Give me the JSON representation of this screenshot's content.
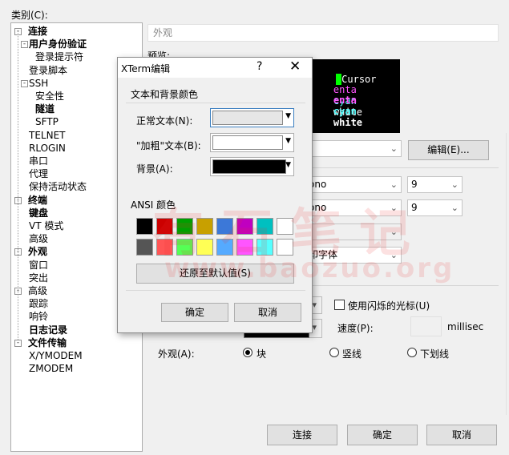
{
  "category_label": "类别(C):",
  "tree": [
    {
      "label": "连接",
      "bold": true,
      "level": 0,
      "toggle": "-"
    },
    {
      "label": "用户身份验证",
      "bold": true,
      "level": 1,
      "toggle": "-"
    },
    {
      "label": "登录提示符",
      "bold": false,
      "level": 2,
      "toggle": ""
    },
    {
      "label": "登录脚本",
      "bold": false,
      "level": 1,
      "toggle": ""
    },
    {
      "label": "SSH",
      "bold": false,
      "level": 1,
      "toggle": "-"
    },
    {
      "label": "安全性",
      "bold": false,
      "level": 2,
      "toggle": ""
    },
    {
      "label": "隧道",
      "bold": true,
      "level": 2,
      "toggle": ""
    },
    {
      "label": "SFTP",
      "bold": false,
      "level": 2,
      "toggle": ""
    },
    {
      "label": "TELNET",
      "bold": false,
      "level": 1,
      "toggle": ""
    },
    {
      "label": "RLOGIN",
      "bold": false,
      "level": 1,
      "toggle": ""
    },
    {
      "label": "串口",
      "bold": false,
      "level": 1,
      "toggle": ""
    },
    {
      "label": "代理",
      "bold": false,
      "level": 1,
      "toggle": ""
    },
    {
      "label": "保持活动状态",
      "bold": false,
      "level": 1,
      "toggle": ""
    },
    {
      "label": "终端",
      "bold": true,
      "level": 0,
      "toggle": "-"
    },
    {
      "label": "键盘",
      "bold": true,
      "level": 1,
      "toggle": ""
    },
    {
      "label": "VT 模式",
      "bold": false,
      "level": 1,
      "toggle": ""
    },
    {
      "label": "高级",
      "bold": false,
      "level": 1,
      "toggle": ""
    },
    {
      "label": "外观",
      "bold": true,
      "level": 0,
      "toggle": "-"
    },
    {
      "label": "窗口",
      "bold": false,
      "level": 1,
      "toggle": ""
    },
    {
      "label": "突出",
      "bold": false,
      "level": 1,
      "toggle": ""
    },
    {
      "label": "高级",
      "bold": false,
      "level": 0,
      "toggle": "-"
    },
    {
      "label": "跟踪",
      "bold": false,
      "level": 1,
      "toggle": ""
    },
    {
      "label": "响铃",
      "bold": false,
      "level": 1,
      "toggle": ""
    },
    {
      "label": "日志记录",
      "bold": true,
      "level": 1,
      "toggle": ""
    },
    {
      "label": "文件传输",
      "bold": true,
      "level": 0,
      "toggle": "-"
    },
    {
      "label": "X/YMODEM",
      "bold": false,
      "level": 1,
      "toggle": ""
    },
    {
      "label": "ZMODEM",
      "bold": false,
      "level": 1,
      "toggle": ""
    }
  ],
  "panel": {
    "title": "外观",
    "preview_label": "预览:",
    "preview_line1": "Cursor",
    "preview_line2": {
      "magenta": "enta",
      "cyan": "cyan",
      "white": "white"
    },
    "preview_line3": {
      "magenta": "enta",
      "cyan": "cyan",
      "white": "white"
    },
    "edit_button": "编辑(E)...",
    "font_combo1": "ono",
    "font_combo2": "ono",
    "size1": "9",
    "size2": "9",
    "char_combo": "印字体",
    "blink_cursor_label": "使用闪烁的光标(U)",
    "speed_label": "速度(P):",
    "speed_unit": "millisec",
    "appearance_label": "外观(A):",
    "cursor_styles": [
      "块",
      "竖线",
      "下划线"
    ]
  },
  "buttons": {
    "connect": "连接",
    "ok": "确定",
    "cancel": "取消"
  },
  "dialog": {
    "title": "XTerm编辑",
    "help_glyph": "?",
    "close_glyph": "✕",
    "group_label": "文本和背景颜色",
    "normal_text_label": "正常文本(N):",
    "bold_text_label": "\"加粗\"文本(B):",
    "background_label": "背景(A):",
    "ansi_label": "ANSI 颜色",
    "restore_button": "还原至默认值(S)",
    "ok_button": "确定",
    "cancel_button": "取消"
  },
  "colors": {
    "normal_text": "#e6e6e6",
    "bold_text": "#ffffff",
    "background": "#000000",
    "ansi_row1": [
      "#000000",
      "#cc0000",
      "#00a000",
      "#c8a000",
      "#3c78d8",
      "#c000c0",
      "#00c0c0",
      "#ffffff"
    ],
    "ansi_row2": [
      "#555555",
      "#ff5555",
      "#55ff55",
      "#ffff55",
      "#55aaff",
      "#ff55ff",
      "#55ffff",
      "#ffffff"
    ],
    "preview_magenta": "#ff55ff",
    "preview_cyan": "#55ffff",
    "preview_white": "#ffffff",
    "cursor_bg": "#00ff00"
  },
  "watermark": {
    "line1": "有石笔记",
    "line2": "www.baozuo.org"
  }
}
